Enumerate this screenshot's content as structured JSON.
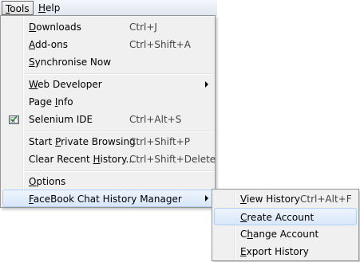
{
  "menubar": {
    "tools": {
      "mnemonic": "T",
      "rest": "ools"
    },
    "help": {
      "mnemonic": "H",
      "rest": "elp"
    }
  },
  "tools_menu": {
    "downloads": {
      "mnemonic": "D",
      "rest": "ownloads",
      "shortcut": "Ctrl+J"
    },
    "addons": {
      "mnemonic": "A",
      "rest": "dd-ons",
      "shortcut": "Ctrl+Shift+A"
    },
    "sync": {
      "mnemonic": "S",
      "rest": "ynchronise Now"
    },
    "webdev": {
      "mnemonic": "W",
      "rest": "eb Developer"
    },
    "pageinfo": {
      "pre": "Page ",
      "mnemonic": "I",
      "rest": "nfo"
    },
    "selenium": {
      "label": "Selenium IDE",
      "shortcut": "Ctrl+Alt+S",
      "icon": "selenium-icon"
    },
    "private": {
      "pre": "Start ",
      "mnemonic": "P",
      "rest": "rivate Browsing",
      "shortcut": "Ctrl+Shift+P"
    },
    "clear": {
      "pre": "Clear Recent ",
      "mnemonic": "H",
      "rest": "istory...",
      "shortcut": "Ctrl+Shift+Delete"
    },
    "options": {
      "mnemonic": "O",
      "rest": "ptions"
    },
    "fb": {
      "mnemonic": "F",
      "rest": "aceBook Chat History Manager"
    }
  },
  "fb_submenu": {
    "view": {
      "mnemonic": "V",
      "rest": "iew History",
      "shortcut": "Ctrl+Alt+F"
    },
    "create": {
      "mnemonic": "C",
      "rest": "reate Account"
    },
    "change": {
      "pre": "C",
      "mnemonic": "h",
      "rest": "ange Account"
    },
    "export": {
      "mnemonic": "E",
      "rest": "xport History"
    }
  },
  "colors": {
    "menu_bg": "#f0f0f0",
    "highlight": "#d8e7fa",
    "highlight_border": "#aecff7"
  }
}
